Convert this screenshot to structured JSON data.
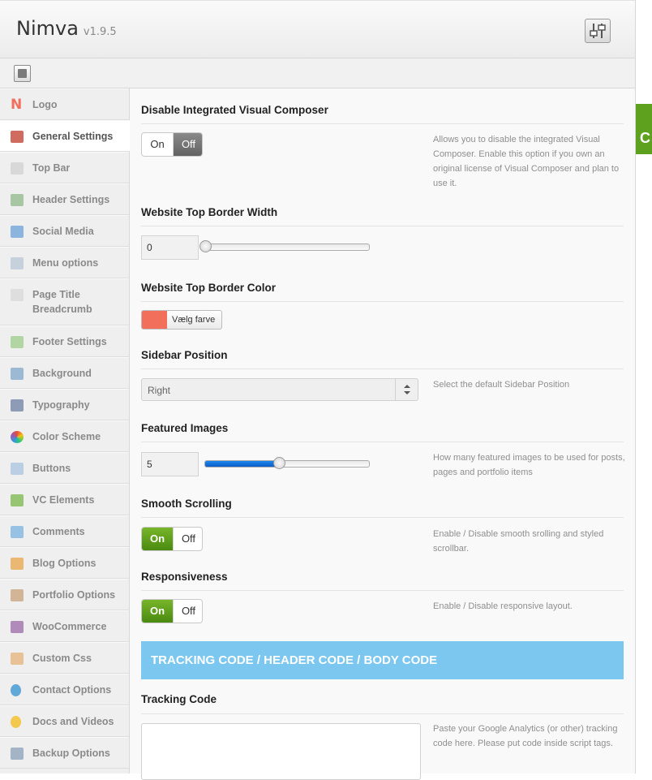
{
  "app": {
    "name": "Nimva",
    "version": "v1.9.5"
  },
  "sidebar": {
    "items": [
      {
        "label": "Logo",
        "icon": "logo-n-icon"
      },
      {
        "label": "General Settings",
        "icon": "tools-icon",
        "active": true
      },
      {
        "label": "Top Bar",
        "icon": "topbar-icon"
      },
      {
        "label": "Header Settings",
        "icon": "header-icon"
      },
      {
        "label": "Social Media",
        "icon": "social-icon"
      },
      {
        "label": "Menu options",
        "icon": "menu-icon"
      },
      {
        "label": "Page Title",
        "label2": "Breadcrumb",
        "icon": "page-title-icon"
      },
      {
        "label": "Footer Settings",
        "icon": "footer-icon"
      },
      {
        "label": "Background",
        "icon": "background-icon"
      },
      {
        "label": "Typography",
        "icon": "typography-icon"
      },
      {
        "label": "Color Scheme",
        "icon": "color-wheel-icon"
      },
      {
        "label": "Buttons",
        "icon": "buttons-icon"
      },
      {
        "label": "VC Elements",
        "icon": "vc-elements-icon"
      },
      {
        "label": "Comments",
        "icon": "comments-icon"
      },
      {
        "label": "Blog Options",
        "icon": "blog-icon"
      },
      {
        "label": "Portfolio Options",
        "icon": "portfolio-icon"
      },
      {
        "label": "WooCommerce",
        "icon": "woocommerce-icon"
      },
      {
        "label": "Custom Css",
        "icon": "css-icon"
      },
      {
        "label": "Contact Options",
        "icon": "contact-icon"
      },
      {
        "label": "Docs and Videos",
        "icon": "lightbulb-icon"
      },
      {
        "label": "Backup Options",
        "icon": "backup-icon"
      }
    ]
  },
  "settings": {
    "vc": {
      "title": "Disable Integrated Visual Composer",
      "on": "On",
      "off": "Off",
      "selected": "off",
      "desc": "Allows you to disable the integrated Visual Composer. Enable this option if you own an original license of Visual Composer and plan to use it."
    },
    "border_width": {
      "title": "Website Top Border Width",
      "value": "0",
      "level": 0
    },
    "border_color": {
      "title": "Website Top Border Color",
      "button": "Vælg farve",
      "color": "#f26f5c"
    },
    "sidebar_pos": {
      "title": "Sidebar Position",
      "value": "Right",
      "desc": "Select the default Sidebar Position"
    },
    "featured": {
      "title": "Featured Images",
      "value": "5",
      "level": 0.45,
      "desc": "How many featured images to be used for posts, pages and portfolio items"
    },
    "smooth": {
      "title": "Smooth Scrolling",
      "on": "On",
      "off": "Off",
      "selected": "on",
      "desc": "Enable / Disable smooth srolling and styled scrollbar."
    },
    "responsive": {
      "title": "Responsiveness",
      "on": "On",
      "off": "Off",
      "selected": "on",
      "desc": "Enable / Disable responsive layout."
    },
    "banner": "TRACKING CODE / HEADER CODE / BODY CODE",
    "tracking": {
      "title": "Tracking Code",
      "desc": "Paste your Google Analytics (or other) tracking code here. Please put code inside script tags."
    }
  },
  "edge_tab": "C",
  "colors": {
    "accent_green": "#5da11e",
    "banner_blue": "#7cc7f0",
    "slider_blue": "#1b89ee"
  }
}
